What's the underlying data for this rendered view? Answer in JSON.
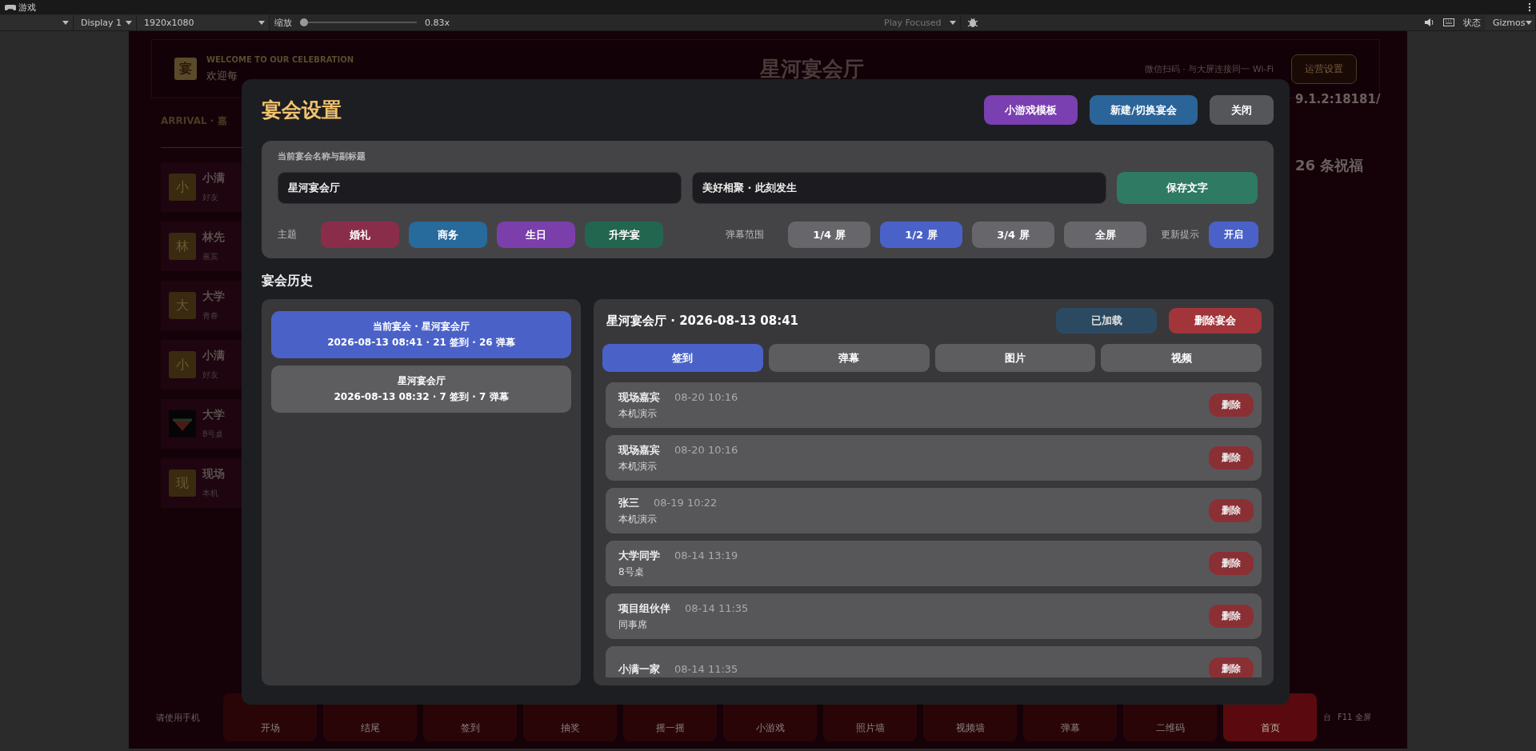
{
  "editor": {
    "tab": "游戏",
    "display": "Display 1",
    "resolution": "1920x1080",
    "zoom_label": "缩放",
    "zoom": {
      "level": 0.0
    },
    "zoom_value": "0.83x",
    "play_mode": "Play Focused",
    "stats": "状态",
    "gizmos": "Gizmos"
  },
  "background": {
    "logo": "宴",
    "welcome": "WELCOME TO OUR CELEBRATION",
    "greeting": "欢迎每",
    "title": "星河宴会厅",
    "wifi_hint": "微信扫码 · 与大屏连接同一 Wi-Fi",
    "ops_button": "运营设置",
    "url": "9.1.2:18181/",
    "arrival": "ARRIVAL · 嘉",
    "wishes": "26 条祝福",
    "guests": [
      {
        "kind": "letter",
        "avatar": "小",
        "name": "小满",
        "note": "好友"
      },
      {
        "kind": "letter",
        "avatar": "林",
        "name": "林先",
        "note": "嘉宾"
      },
      {
        "kind": "letter",
        "avatar": "大",
        "name": "大学",
        "note": "青春"
      },
      {
        "kind": "letter",
        "avatar": "小",
        "name": "小满",
        "note": "好友"
      },
      {
        "kind": "photo",
        "name": "大学",
        "note": "8号桌"
      },
      {
        "kind": "letter",
        "avatar": "现",
        "name": "现场",
        "note": "本机"
      }
    ],
    "hint": "请使用手机",
    "nav": [
      {
        "label": "开场",
        "selected": false
      },
      {
        "label": "结尾",
        "selected": false
      },
      {
        "label": "签到",
        "selected": false
      },
      {
        "label": "抽奖",
        "selected": false
      },
      {
        "label": "摇一摇",
        "selected": false
      },
      {
        "label": "小游戏",
        "selected": false
      },
      {
        "label": "照片墙",
        "selected": false
      },
      {
        "label": "视频墙",
        "selected": false
      },
      {
        "label": "弹幕",
        "selected": false
      },
      {
        "label": "二维码",
        "selected": false
      },
      {
        "label": "首页",
        "selected": true
      }
    ],
    "footer_notes": [
      "台",
      "F11 全屏"
    ]
  },
  "dialog": {
    "title": "宴会设置",
    "header_buttons": [
      {
        "label": "小游戏模板",
        "color": "#7a3fb0"
      },
      {
        "label": "新建/切换宴会",
        "color": "#2b6498"
      },
      {
        "label": "关闭",
        "color": "#55565a"
      }
    ],
    "name_section": {
      "label": "当前宴会名称与副标题",
      "name": "星河宴会厅",
      "subtitle": "美好相聚 · 此刻发生",
      "save": "保存文字"
    },
    "theme_label": "主题",
    "themes": [
      {
        "label": "婚礼",
        "color": "#8a2d4a"
      },
      {
        "label": "商务",
        "color": "#276a9c"
      },
      {
        "label": "生日",
        "color": "#7b3fab"
      },
      {
        "label": "升学宴",
        "color": "#23664f"
      }
    ],
    "danmaku_label": "弹幕范围",
    "danmaku_ranges": [
      {
        "label": "1/4 屏",
        "selected": false
      },
      {
        "label": "1/2 屏",
        "selected": true
      },
      {
        "label": "3/4 屏",
        "selected": false
      },
      {
        "label": "全屏",
        "selected": false
      }
    ],
    "update_label": "更新提示",
    "update_toggle": {
      "label": "开启",
      "on": true
    },
    "history_title": "宴会历史",
    "history": [
      {
        "title": "当前宴会 · 星河宴会厅",
        "meta": "2026-08-13 08:41 · 21 签到 · 26 弹幕",
        "selected": true
      },
      {
        "title": "星河宴会厅",
        "meta": "2026-08-13 08:32 · 7 签到 · 7 弹幕",
        "selected": false
      }
    ],
    "detail": {
      "title": "星河宴会厅 · 2026-08-13 08:41",
      "loaded_button": {
        "label": "已加载",
        "disabled": true
      },
      "delete_button": "删除宴会",
      "tabs": [
        {
          "label": "签到",
          "selected": true
        },
        {
          "label": "弹幕",
          "selected": false
        },
        {
          "label": "图片",
          "selected": false
        },
        {
          "label": "视频",
          "selected": false
        }
      ],
      "records": [
        {
          "name": "现场嘉宾",
          "time": "08-20 10:16",
          "note": "本机演示",
          "action": "删除"
        },
        {
          "name": "现场嘉宾",
          "time": "08-20 10:16",
          "note": "本机演示",
          "action": "删除"
        },
        {
          "name": "张三",
          "time": "08-19 10:22",
          "note": "本机演示",
          "action": "删除"
        },
        {
          "name": "大学同学",
          "time": "08-14 13:19",
          "note": "8号桌",
          "action": "删除"
        },
        {
          "name": "项目组伙伴",
          "time": "08-14 11:35",
          "note": "同事席",
          "action": "删除"
        },
        {
          "name": "小满一家",
          "time": "08-14 11:35",
          "action": "删除"
        }
      ]
    }
  }
}
